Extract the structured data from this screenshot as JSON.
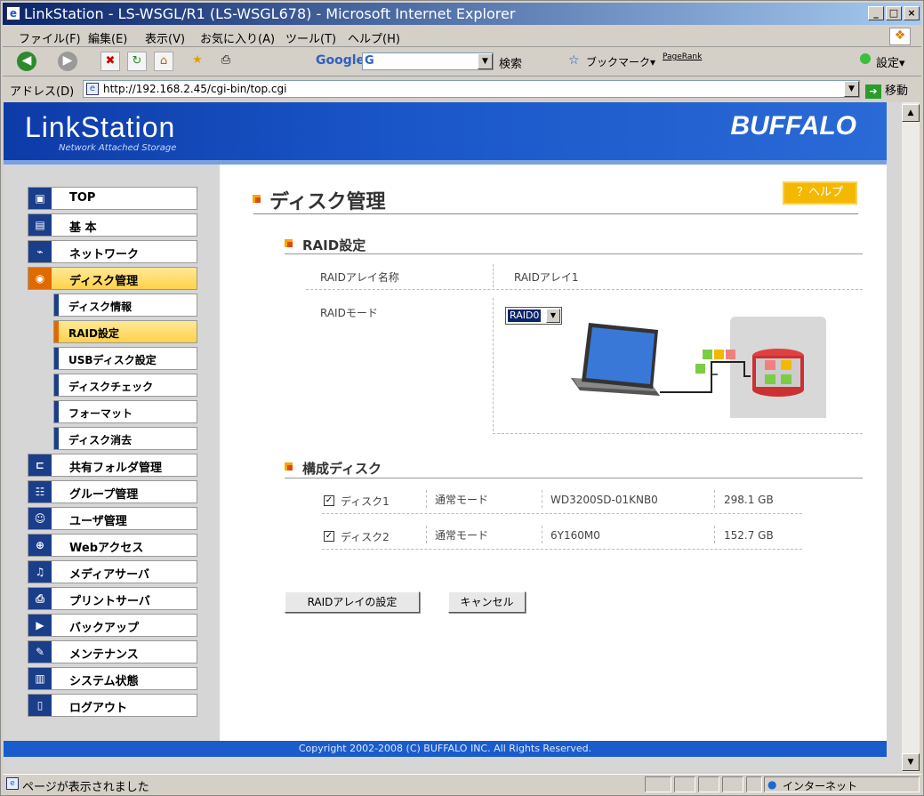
{
  "window": {
    "title": "LinkStation - LS-WSGL/R1 (LS-WSGL678) - Microsoft Internet Explorer",
    "min": "_",
    "max": "□",
    "close": "×"
  },
  "menu": [
    "ファイル(F)",
    "編集(E)",
    "表示(V)",
    "お気に入り(A)",
    "ツール(T)",
    "ヘルプ(H)"
  ],
  "toolbar": {
    "google": "Google",
    "search_label": "検索",
    "bookmark": "ブックマーク▾",
    "pagerank": "PageRank",
    "settings": "設定▾"
  },
  "address": {
    "label": "アドレス(D)",
    "url": "http://192.168.2.45/cgi-bin/top.cgi",
    "go": "移動"
  },
  "header": {
    "logo": "LinkStation",
    "subtitle": "Network Attached Storage",
    "brand": "BUFFALO"
  },
  "nav": [
    {
      "label": "TOP",
      "icon": "top-icon"
    },
    {
      "label": "基 本",
      "icon": "basic-icon"
    },
    {
      "label": "ネットワーク",
      "icon": "network-icon"
    },
    {
      "label": "ディスク管理",
      "icon": "disk-icon"
    },
    {
      "label": "共有フォルダ管理",
      "icon": "shared-folder-icon"
    },
    {
      "label": "グループ管理",
      "icon": "group-icon"
    },
    {
      "label": "ユーザ管理",
      "icon": "user-icon"
    },
    {
      "label": "Webアクセス",
      "icon": "web-access-icon"
    },
    {
      "label": "メディアサーバ",
      "icon": "media-server-icon"
    },
    {
      "label": "プリントサーバ",
      "icon": "print-server-icon"
    },
    {
      "label": "バックアップ",
      "icon": "backup-icon"
    },
    {
      "label": "メンテナンス",
      "icon": "maintenance-icon"
    },
    {
      "label": "システム状態",
      "icon": "system-status-icon"
    },
    {
      "label": "ログアウト",
      "icon": "logout-icon"
    }
  ],
  "subnav": [
    "ディスク情報",
    "RAID設定",
    "USBディスク設定",
    "ディスクチェック",
    "フォーマット",
    "ディスク消去"
  ],
  "page": {
    "title": "ディスク管理",
    "help": "？ヘルプ"
  },
  "raid": {
    "section_title": "RAID設定",
    "name_label": "RAIDアレイ名称",
    "name_value": "RAIDアレイ1",
    "mode_label": "RAIDモード",
    "mode_value": "RAID0"
  },
  "disks": {
    "section_title": "構成ディスク",
    "rows": [
      {
        "name": "ディスク1",
        "mode": "通常モード",
        "model": "WD3200SD-01KNB0",
        "size": "298.1 GB",
        "checked": true
      },
      {
        "name": "ディスク2",
        "mode": "通常モード",
        "model": "6Y160M0",
        "size": "152.7 GB",
        "checked": true
      }
    ]
  },
  "buttons": {
    "apply": "RAIDアレイの設定",
    "cancel": "キャンセル"
  },
  "footer": "Copyright 2002-2008 (C) BUFFALO INC. All Rights Reserved.",
  "status": {
    "text": "ページが表示されました",
    "zone": "インターネット"
  }
}
